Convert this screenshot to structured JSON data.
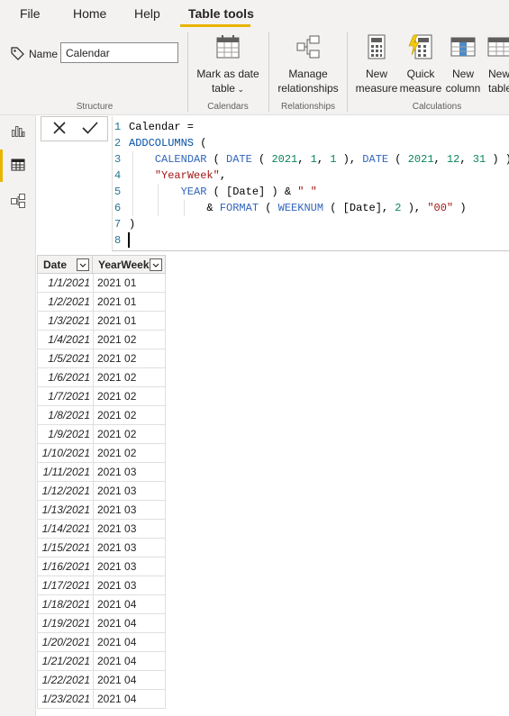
{
  "menu": {
    "tabs": [
      "File",
      "Home",
      "Help",
      "Table tools"
    ],
    "active": "Table tools",
    "accent": "#e8b400"
  },
  "ribbon": {
    "name_label": "Name",
    "name_value": "Calendar",
    "mark_date_line1": "Mark as date",
    "mark_date_line2": "table",
    "manage_line1": "Manage",
    "manage_line2": "relationships",
    "new_measure_line1": "New",
    "new_measure_line2": "measure",
    "quick_measure_line1": "Quick",
    "quick_measure_line2": "measure",
    "new_column_line1": "New",
    "new_column_line2": "column",
    "new_table_line1": "New",
    "new_table_line2": "table",
    "groups": [
      "Structure",
      "Calendars",
      "Relationships",
      "Calculations"
    ]
  },
  "rail": {
    "icons": [
      "report-view-icon",
      "data-view-icon",
      "model-view-icon"
    ],
    "active": "data-view-icon"
  },
  "formula": {
    "line_numbers": [
      "1",
      "2",
      "3",
      "4",
      "5",
      "6",
      "7",
      "8"
    ]
  },
  "grid": {
    "columns": [
      "Date",
      "YearWeek"
    ],
    "rows": [
      [
        "1/1/2021",
        "2021 01"
      ],
      [
        "1/2/2021",
        "2021 01"
      ],
      [
        "1/3/2021",
        "2021 01"
      ],
      [
        "1/4/2021",
        "2021 02"
      ],
      [
        "1/5/2021",
        "2021 02"
      ],
      [
        "1/6/2021",
        "2021 02"
      ],
      [
        "1/7/2021",
        "2021 02"
      ],
      [
        "1/8/2021",
        "2021 02"
      ],
      [
        "1/9/2021",
        "2021 02"
      ],
      [
        "1/10/2021",
        "2021 02"
      ],
      [
        "1/11/2021",
        "2021 03"
      ],
      [
        "1/12/2021",
        "2021 03"
      ],
      [
        "1/13/2021",
        "2021 03"
      ],
      [
        "1/14/2021",
        "2021 03"
      ],
      [
        "1/15/2021",
        "2021 03"
      ],
      [
        "1/16/2021",
        "2021 03"
      ],
      [
        "1/17/2021",
        "2021 03"
      ],
      [
        "1/18/2021",
        "2021 04"
      ],
      [
        "1/19/2021",
        "2021 04"
      ],
      [
        "1/20/2021",
        "2021 04"
      ],
      [
        "1/21/2021",
        "2021 04"
      ],
      [
        "1/22/2021",
        "2021 04"
      ],
      [
        "1/23/2021",
        "2021 04"
      ]
    ]
  }
}
